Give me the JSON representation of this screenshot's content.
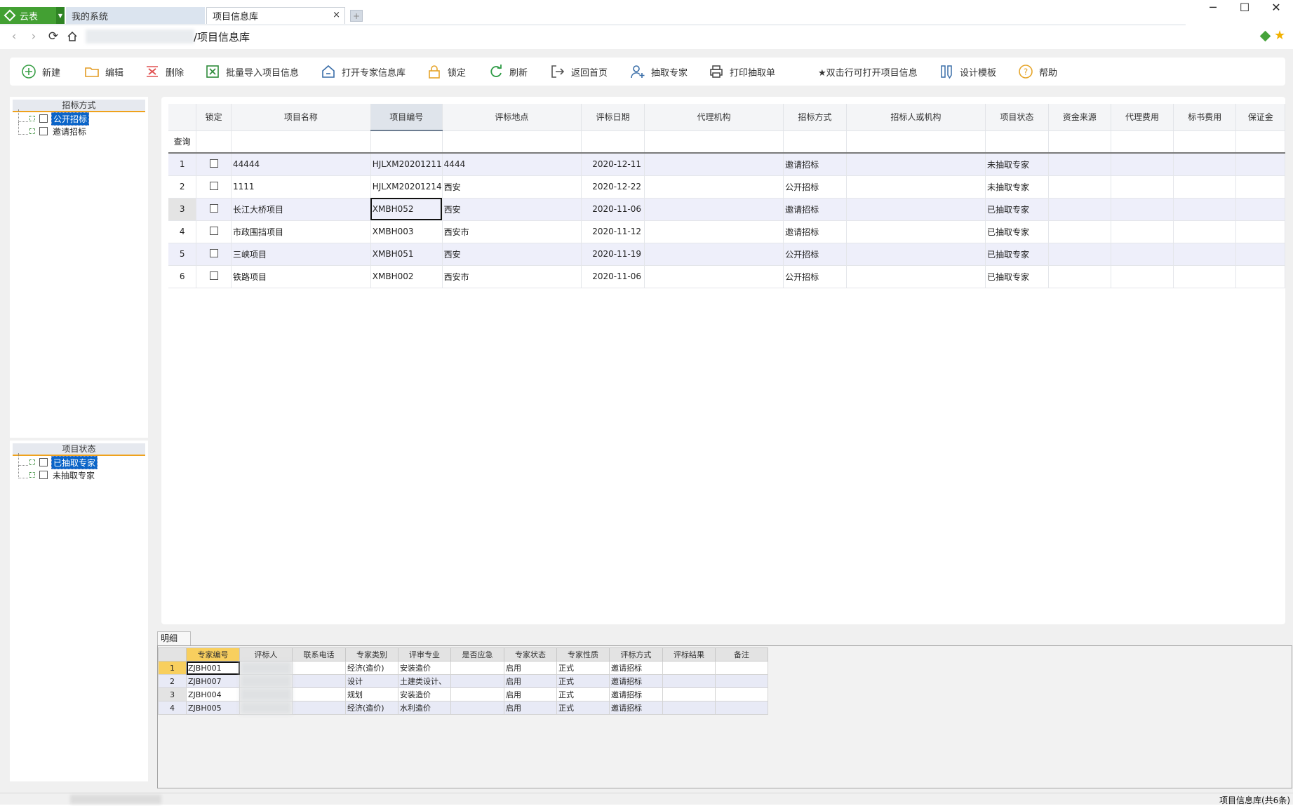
{
  "app": {
    "brand": "云表",
    "tabs": [
      {
        "label": "我的系统",
        "active": false
      },
      {
        "label": "项目信息库",
        "active": true
      }
    ],
    "tab_close": "×",
    "tab_add": "+"
  },
  "window_controls": {
    "minimize": "─",
    "maximize": "☐",
    "close": "✕"
  },
  "address": {
    "title": "/项目信息库"
  },
  "toolbar": {
    "new": "新建",
    "edit": "编辑",
    "delete": "删除",
    "batch_import": "批量导入项目信息",
    "open_expert_db": "打开专家信息库",
    "lock": "锁定",
    "refresh": "刷新",
    "back_home": "返回首页",
    "draw_expert": "抽取专家",
    "print_draw": "打印抽取单",
    "dblclick_hint": "★双击行可打开项目信息",
    "design_template": "设计模板",
    "help": "帮助"
  },
  "filters": {
    "bid_method": {
      "title": "招标方式",
      "items": [
        {
          "label": "公开招标",
          "selected": true
        },
        {
          "label": "邀请招标",
          "selected": false
        }
      ]
    },
    "project_status": {
      "title": "项目状态",
      "items": [
        {
          "label": "已抽取专家",
          "selected": true
        },
        {
          "label": "未抽取专家",
          "selected": false
        }
      ]
    }
  },
  "grid": {
    "columns": [
      "锁定",
      "项目名称",
      "项目编号",
      "评标地点",
      "评标日期",
      "代理机构",
      "招标方式",
      "招标人或机构",
      "项目状态",
      "资金来源",
      "代理费用",
      "标书费用",
      "保证金"
    ],
    "query_label": "查询",
    "rows": [
      {
        "no": "1",
        "name": "44444",
        "code": "HJLXM20201211",
        "place": "4444",
        "date": "2020-12-11",
        "agency": "",
        "method": "邀请招标",
        "tenderer": "",
        "status": "未抽取专家"
      },
      {
        "no": "2",
        "name": "1111",
        "code": "HJLXM20201214",
        "place": "西安",
        "date": "2020-12-22",
        "agency": "",
        "method": "公开招标",
        "tenderer": "",
        "status": "未抽取专家"
      },
      {
        "no": "3",
        "name": "长江大桥项目",
        "code": "XMBH052",
        "place": "西安",
        "date": "2020-11-06",
        "agency": "",
        "method": "邀请招标",
        "tenderer": "",
        "status": "已抽取专家"
      },
      {
        "no": "4",
        "name": "市政围挡项目",
        "code": "XMBH003",
        "place": "西安市",
        "date": "2020-11-12",
        "agency": "",
        "method": "邀请招标",
        "tenderer": "",
        "status": "已抽取专家"
      },
      {
        "no": "5",
        "name": "三峡项目",
        "code": "XMBH051",
        "place": "西安",
        "date": "2020-11-19",
        "agency": "",
        "method": "公开招标",
        "tenderer": "",
        "status": "已抽取专家"
      },
      {
        "no": "6",
        "name": "铁路项目",
        "code": "XMBH002",
        "place": "西安市",
        "date": "2020-11-06",
        "agency": "",
        "method": "公开招标",
        "tenderer": "",
        "status": "已抽取专家"
      }
    ]
  },
  "detail": {
    "tab_label": "明细",
    "columns": [
      "专家编号",
      "评标人",
      "联系电话",
      "专家类别",
      "评审专业",
      "是否应急",
      "专家状态",
      "专家性质",
      "评标方式",
      "评标结果",
      "备注"
    ],
    "rows": [
      {
        "no": "1",
        "code": "ZJBH001",
        "category": "经济(造价)",
        "major": "安装造价",
        "state": "启用",
        "nature": "正式",
        "method": "邀请招标"
      },
      {
        "no": "2",
        "code": "ZJBH007",
        "category": "设计",
        "major": "土建类设计、",
        "state": "启用",
        "nature": "正式",
        "method": "邀请招标"
      },
      {
        "no": "3",
        "code": "ZJBH004",
        "category": "规划",
        "major": "安装造价",
        "state": "启用",
        "nature": "正式",
        "method": "邀请招标"
      },
      {
        "no": "4",
        "code": "ZJBH005",
        "category": "经济(造价)",
        "major": "水利造价",
        "state": "启用",
        "nature": "正式",
        "method": "邀请招标"
      }
    ]
  },
  "status_bar": {
    "text": "项目信息库(共6条)"
  }
}
